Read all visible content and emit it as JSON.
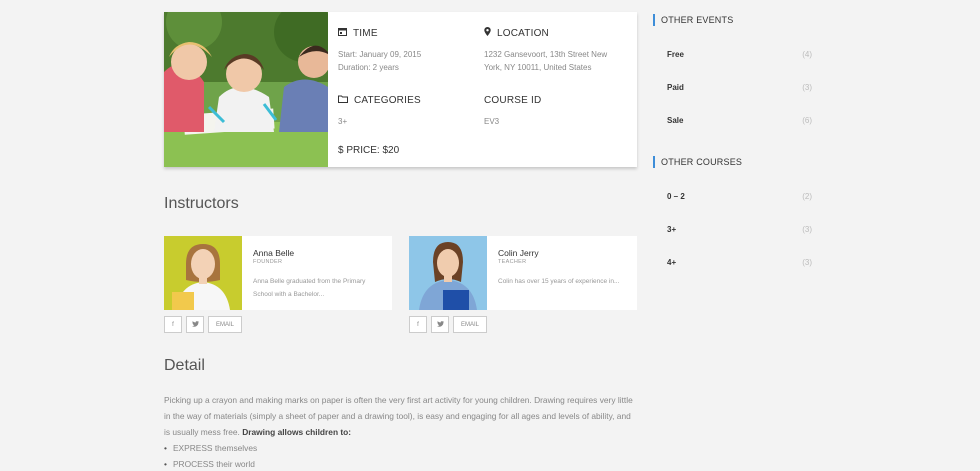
{
  "course_info": {
    "time": {
      "title": "TIME",
      "line1": "Start: January 09, 2015",
      "line2": "Duration: 2 years"
    },
    "location": {
      "title": "LOCATION",
      "line1": "1232 Gansevoort, 13th Street New",
      "line2": "York, NY 10011, United States"
    },
    "categories": {
      "title": "CATEGORIES",
      "value": "3+"
    },
    "course_id": {
      "title": "COURSE ID",
      "value": "EV3"
    },
    "price": {
      "label": "$ PRICE:",
      "value": "$20"
    }
  },
  "instructors": {
    "heading": "Instructors",
    "items": [
      {
        "name": "Anna Belle",
        "role": "FOUNDER",
        "bio1": "Anna Belle graduated from the Primary",
        "bio2": "School with a Bachelor...",
        "facebook": "f",
        "twitter": "t",
        "email": "EMAIL"
      },
      {
        "name": "Colin Jerry",
        "role": "TEACHER",
        "bio1": "Colin has over 15 years of experience in...",
        "bio2": "",
        "facebook": "f",
        "twitter": "t",
        "email": "EMAIL"
      }
    ]
  },
  "detail": {
    "heading": "Detail",
    "paragraph": "Picking up a crayon and making marks on paper is often the very first art activity for young children. Drawing requires very little in the way of materials (simply a sheet of paper and a drawing tool), is easy and engaging for all ages and levels of ability, and is usually mess free.",
    "bold": "Drawing allows children to:",
    "bullets": [
      "EXPRESS themselves",
      "PROCESS their world"
    ]
  },
  "sidebar": {
    "events_heading": "OTHER EVENTS",
    "events": [
      {
        "label": "Free",
        "count": "(4)"
      },
      {
        "label": "Paid",
        "count": "(3)"
      },
      {
        "label": "Sale",
        "count": "(6)"
      }
    ],
    "courses_heading": "OTHER COURSES",
    "courses": [
      {
        "label": "0 – 2",
        "count": "(2)"
      },
      {
        "label": "3+",
        "count": "(3)"
      },
      {
        "label": "4+",
        "count": "(3)"
      }
    ]
  },
  "colors": {
    "accent": "#3d8dd8",
    "background": "#f3f3f3",
    "card": "#ffffff"
  }
}
